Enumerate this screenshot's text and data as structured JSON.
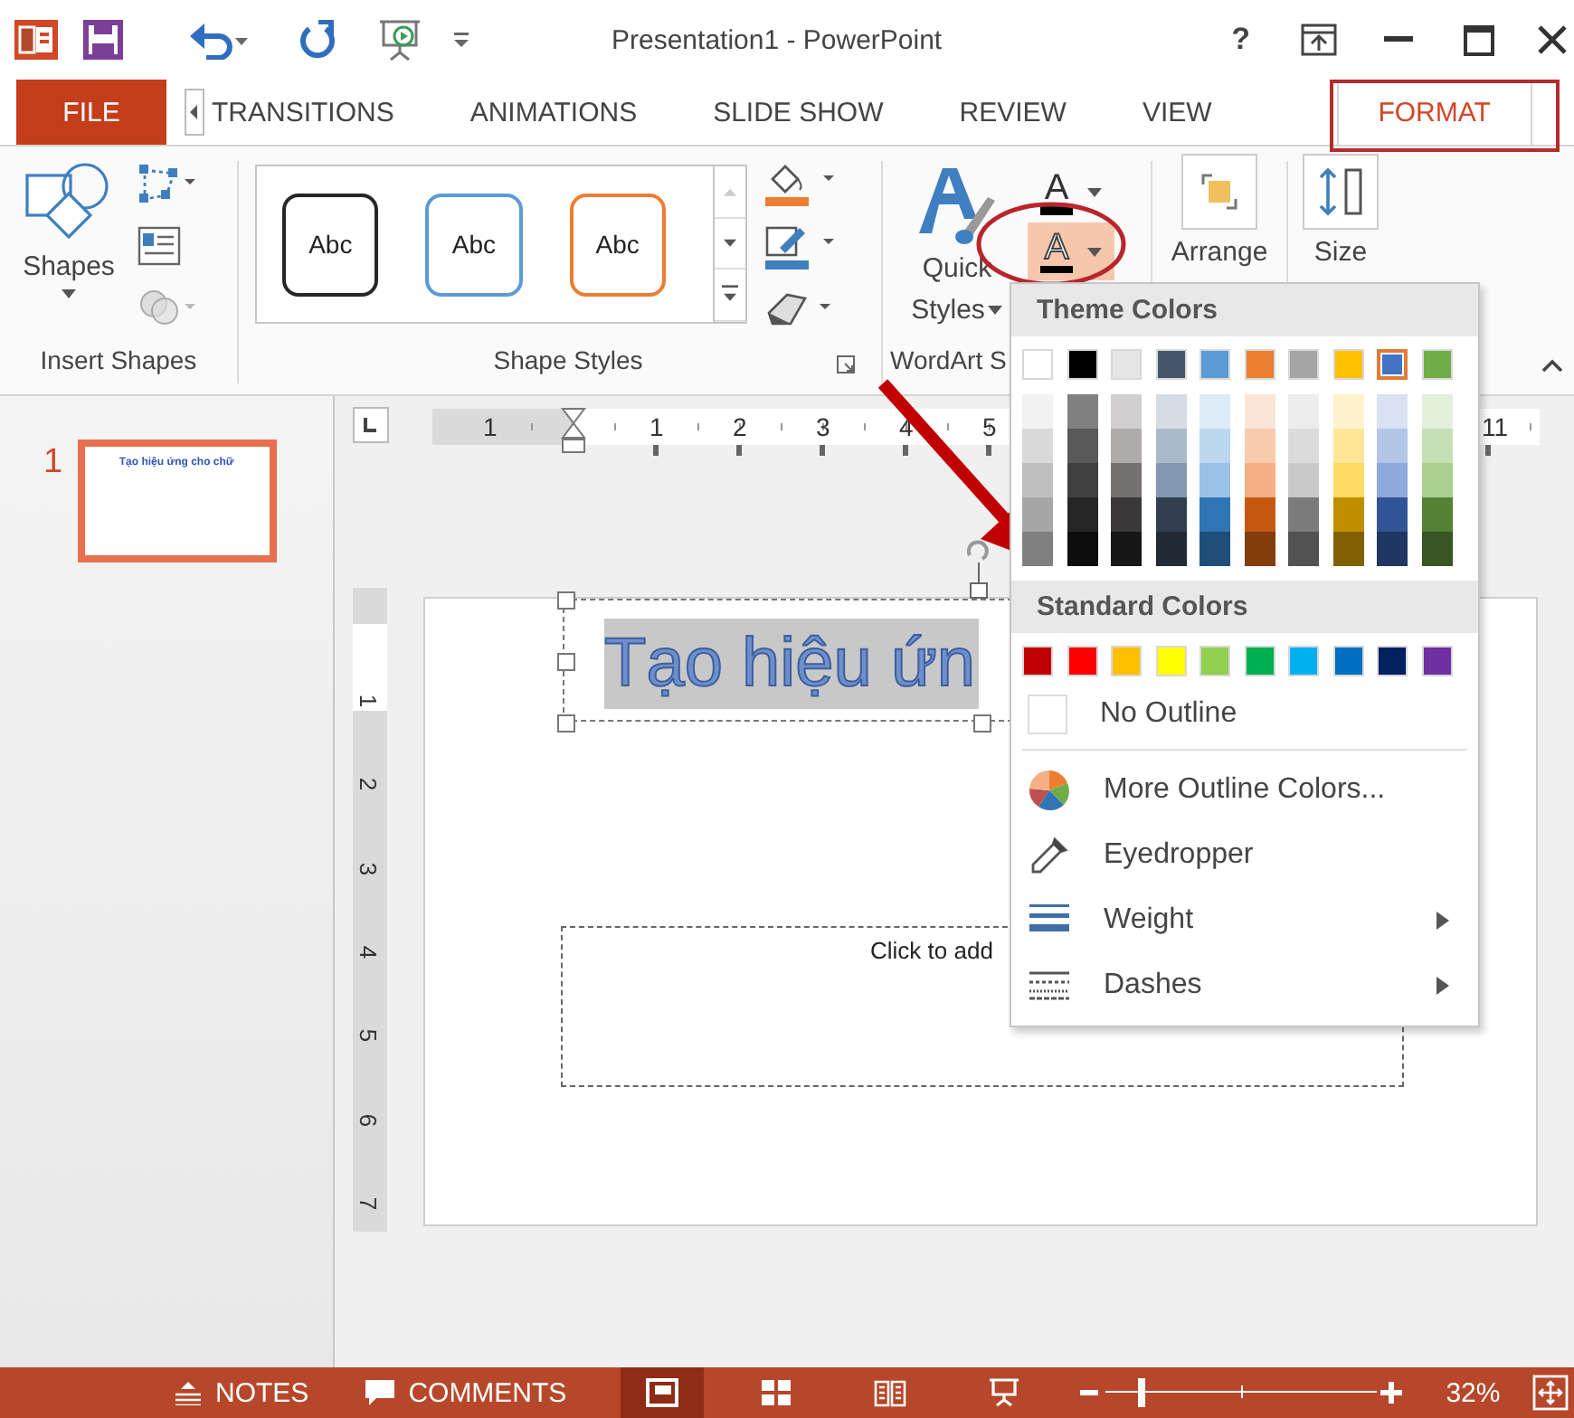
{
  "title_bar": {
    "title": "Presentation1 - PowerPoint",
    "help": "?"
  },
  "tabs": [
    {
      "label": "FILE",
      "kind": "file",
      "selected": false
    },
    {
      "label": "TRANSITIONS",
      "kind": "tab",
      "selected": false
    },
    {
      "label": "ANIMATIONS",
      "kind": "tab",
      "selected": false
    },
    {
      "label": "SLIDE SHOW",
      "kind": "tab",
      "selected": false
    },
    {
      "label": "REVIEW",
      "kind": "tab",
      "selected": false
    },
    {
      "label": "VIEW",
      "kind": "tab",
      "selected": false
    },
    {
      "label": "FORMAT",
      "kind": "tab",
      "selected": true
    }
  ],
  "ribbon": {
    "insert_shapes": {
      "shapes_label": "Shapes",
      "group_label": "Insert Shapes"
    },
    "shape_styles": {
      "presets": [
        {
          "label": "Abc",
          "color": "#262626"
        },
        {
          "label": "Abc",
          "color": "#5b9bd5"
        },
        {
          "label": "Abc",
          "color": "#ed7d31"
        }
      ],
      "group_label": "Shape Styles"
    },
    "wordart": {
      "quick_styles": [
        "Quick",
        "Styles"
      ],
      "text_fill_glyph": "A",
      "text_outline_glyph": "A",
      "text_outline_active": true,
      "group_label": "WordArt S"
    },
    "arrange": {
      "label": "Arrange"
    },
    "size": {
      "label": "Size"
    }
  },
  "slides_pane": {
    "slides": [
      {
        "number": "1",
        "title": "Tạo hiệu ứng cho chữ",
        "selected": true
      }
    ]
  },
  "ruler": {
    "labels": [
      "1",
      "1",
      "2",
      "3",
      "4",
      "5",
      "11"
    ]
  },
  "vertical_ruler": {
    "labels": [
      "1",
      "2",
      "3",
      "4",
      "5",
      "6",
      "7"
    ]
  },
  "slide": {
    "title": "Tạo hiệu ứn",
    "subtitle_placeholder": "Click to add"
  },
  "outline_menu": {
    "theme_header": "Theme Colors",
    "theme_colors": [
      {
        "color": "#ffffff",
        "selected": false
      },
      {
        "color": "#000000",
        "selected": false
      },
      {
        "color": "#e7e6e6",
        "selected": false
      },
      {
        "color": "#44546a",
        "selected": false
      },
      {
        "color": "#5b9bd5",
        "selected": false
      },
      {
        "color": "#ed7d31",
        "selected": false
      },
      {
        "color": "#a5a5a5",
        "selected": false
      },
      {
        "color": "#ffc000",
        "selected": false
      },
      {
        "color": "#4472c4",
        "selected": true
      },
      {
        "color": "#70ad47",
        "selected": false
      }
    ],
    "shades": [
      [
        {
          "color": "#f2f2f2",
          "selected": false
        },
        {
          "color": "#d9d9d9",
          "selected": false
        },
        {
          "color": "#bfbfbf",
          "selected": false
        },
        {
          "color": "#a6a6a6",
          "selected": false
        },
        {
          "color": "#808080",
          "selected": false
        }
      ],
      [
        {
          "color": "#808080",
          "selected": false
        },
        {
          "color": "#595959",
          "selected": false
        },
        {
          "color": "#404040",
          "selected": false
        },
        {
          "color": "#262626",
          "selected": false
        },
        {
          "color": "#0d0d0d",
          "selected": false
        }
      ],
      [
        {
          "color": "#d0cece",
          "selected": false
        },
        {
          "color": "#afabab",
          "selected": false
        },
        {
          "color": "#767171",
          "selected": false
        },
        {
          "color": "#3a3838",
          "selected": false
        },
        {
          "color": "#171616",
          "selected": false
        }
      ],
      [
        {
          "color": "#d6dce4",
          "selected": false
        },
        {
          "color": "#acb9ca",
          "selected": false
        },
        {
          "color": "#8497b0",
          "selected": false
        },
        {
          "color": "#333f4f",
          "selected": false
        },
        {
          "color": "#222a35",
          "selected": false
        }
      ],
      [
        {
          "color": "#ddebf7",
          "selected": false
        },
        {
          "color": "#bdd7ee",
          "selected": false
        },
        {
          "color": "#9bc2e6",
          "selected": false
        },
        {
          "color": "#2f75b5",
          "selected": false
        },
        {
          "color": "#1f4e78",
          "selected": false
        }
      ],
      [
        {
          "color": "#fce4d6",
          "selected": false
        },
        {
          "color": "#f8cbad",
          "selected": false
        },
        {
          "color": "#f4b084",
          "selected": false
        },
        {
          "color": "#c65911",
          "selected": false
        },
        {
          "color": "#833c0c",
          "selected": false
        }
      ],
      [
        {
          "color": "#ededed",
          "selected": false
        },
        {
          "color": "#dbdbdb",
          "selected": false
        },
        {
          "color": "#c9c9c9",
          "selected": false
        },
        {
          "color": "#7b7b7b",
          "selected": false
        },
        {
          "color": "#525252",
          "selected": false
        }
      ],
      [
        {
          "color": "#fff2cc",
          "selected": false
        },
        {
          "color": "#ffe699",
          "selected": false
        },
        {
          "color": "#ffd966",
          "selected": false
        },
        {
          "color": "#bf8f00",
          "selected": false
        },
        {
          "color": "#806000",
          "selected": false
        }
      ],
      [
        {
          "color": "#d9e1f2",
          "selected": false
        },
        {
          "color": "#b4c6e7",
          "selected": false
        },
        {
          "color": "#8ea9db",
          "selected": false
        },
        {
          "color": "#305496",
          "selected": false
        },
        {
          "color": "#203764",
          "selected": false
        }
      ],
      [
        {
          "color": "#e2efda",
          "selected": false
        },
        {
          "color": "#c6e0b4",
          "selected": false
        },
        {
          "color": "#a9d08e",
          "selected": false
        },
        {
          "color": "#548235",
          "selected": false
        },
        {
          "color": "#375623",
          "selected": false
        }
      ]
    ],
    "standard_header": "Standard Colors",
    "standard_colors": [
      {
        "color": "#c00000",
        "selected": false
      },
      {
        "color": "#ff0000",
        "selected": false
      },
      {
        "color": "#ffc000",
        "selected": false
      },
      {
        "color": "#ffff00",
        "selected": false
      },
      {
        "color": "#92d050",
        "selected": false
      },
      {
        "color": "#00b050",
        "selected": false
      },
      {
        "color": "#00b0f0",
        "selected": false
      },
      {
        "color": "#0070c0",
        "selected": false
      },
      {
        "color": "#002060",
        "selected": false
      },
      {
        "color": "#7030a0",
        "selected": false
      }
    ],
    "items": [
      {
        "label": "No Outline",
        "kind": "none",
        "submenu": false
      },
      {
        "label": "More Outline Colors...",
        "kind": "palette",
        "submenu": false
      },
      {
        "label": "Eyedropper",
        "kind": "eyedropper",
        "submenu": false
      },
      {
        "label": "Weight",
        "kind": "weight",
        "submenu": true
      },
      {
        "label": "Dashes",
        "kind": "dashes",
        "submenu": true
      }
    ]
  },
  "status_bar": {
    "notes": "NOTES",
    "comments": "COMMENTS",
    "views": [
      {
        "kind": "normal",
        "selected": true
      },
      {
        "kind": "sorter",
        "selected": false
      },
      {
        "kind": "reading",
        "selected": false
      },
      {
        "kind": "slideshow",
        "selected": false
      }
    ],
    "zoom": {
      "level": 0.13,
      "percent": "32%"
    }
  }
}
